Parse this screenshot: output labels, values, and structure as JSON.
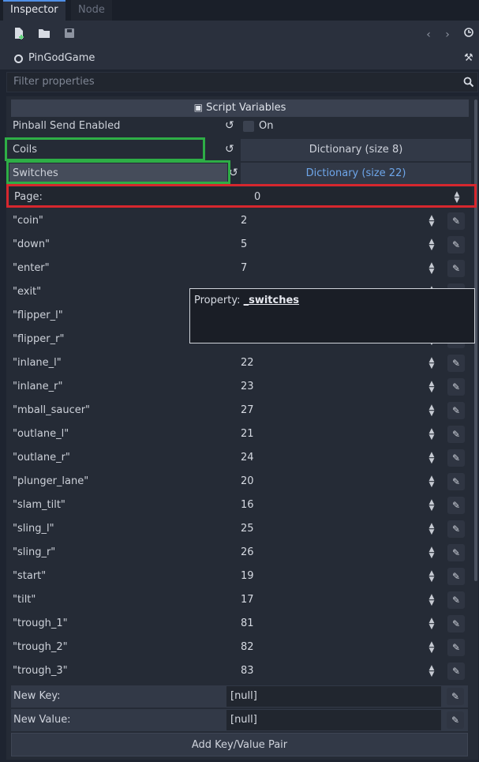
{
  "tabs": [
    {
      "label": "Inspector",
      "active": true
    },
    {
      "label": "Node",
      "active": false
    }
  ],
  "toolbar": {
    "icons": [
      "new-resource-icon",
      "open-folder-icon",
      "save-icon",
      "back-arrow-icon",
      "forward-arrow-icon",
      "history-icon"
    ]
  },
  "object": {
    "name": "PinGodGame",
    "tool_icon": "wrench-screwdriver-icon"
  },
  "filter": {
    "placeholder": "Filter properties"
  },
  "section": {
    "title": "Script Variables"
  },
  "props": {
    "pinball_send_enabled": {
      "label": "Pinball Send Enabled",
      "value": "On",
      "checked": false
    },
    "coils": {
      "label": "Coils",
      "value": "Dictionary (size 8)"
    },
    "switches": {
      "label": "Switches",
      "value": "Dictionary (size 22)"
    },
    "page": {
      "label": "Page:",
      "value": "0"
    }
  },
  "entries": [
    {
      "key": "\"coin\"",
      "value": "2"
    },
    {
      "key": "\"down\"",
      "value": "5"
    },
    {
      "key": "\"enter\"",
      "value": "7"
    },
    {
      "key": "\"exit\"",
      "value": ""
    },
    {
      "key": "\"flipper_l\"",
      "value": ""
    },
    {
      "key": "\"flipper_r\"",
      "value": ""
    },
    {
      "key": "\"inlane_l\"",
      "value": "22"
    },
    {
      "key": "\"inlane_r\"",
      "value": "23"
    },
    {
      "key": "\"mball_saucer\"",
      "value": "27"
    },
    {
      "key": "\"outlane_l\"",
      "value": "21"
    },
    {
      "key": "\"outlane_r\"",
      "value": "24"
    },
    {
      "key": "\"plunger_lane\"",
      "value": "20"
    },
    {
      "key": "\"slam_tilt\"",
      "value": "16"
    },
    {
      "key": "\"sling_l\"",
      "value": "25"
    },
    {
      "key": "\"sling_r\"",
      "value": "26"
    },
    {
      "key": "\"start\"",
      "value": "19"
    },
    {
      "key": "\"tilt\"",
      "value": "17"
    },
    {
      "key": "\"trough_1\"",
      "value": "81"
    },
    {
      "key": "\"trough_2\"",
      "value": "82"
    },
    {
      "key": "\"trough_3\"",
      "value": "83"
    }
  ],
  "tooltip": {
    "prefix": "Property:",
    "name": "_switches"
  },
  "footer": {
    "new_key_label": "New Key:",
    "new_key_value": "[null]",
    "new_value_label": "New Value:",
    "new_value_value": "[null]",
    "add_button": "Add Key/Value Pair"
  },
  "colors": {
    "accent": "#4f8fe6",
    "highlight_green": "#2eae46",
    "highlight_red": "#d6272e",
    "link_blue": "#6ea6ea"
  }
}
